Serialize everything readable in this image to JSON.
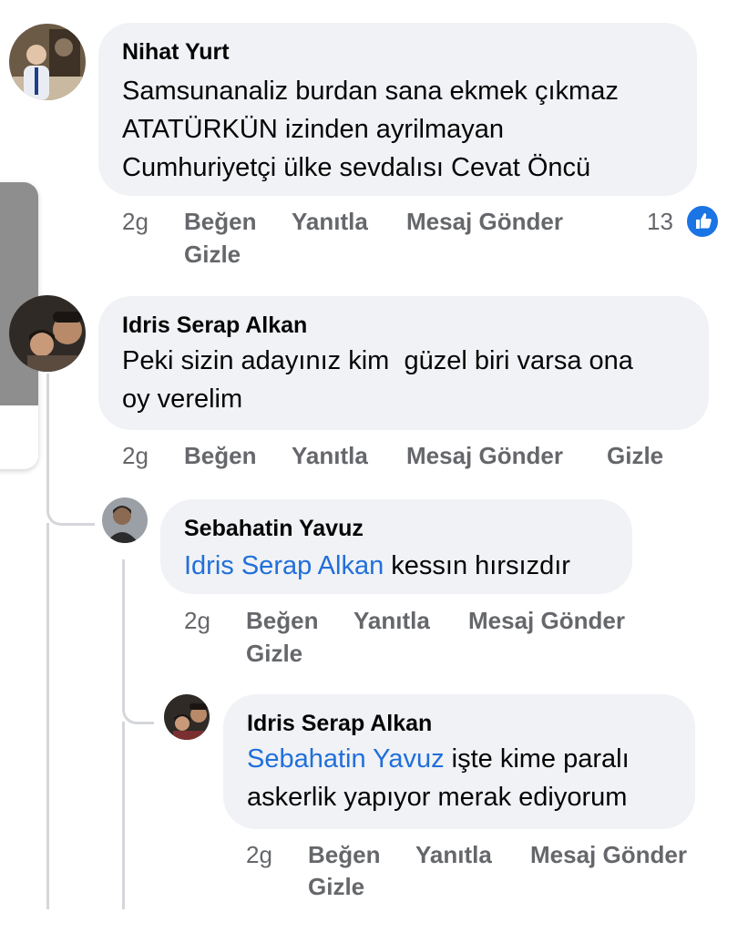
{
  "comments": [
    {
      "author": "Nihat Yurt",
      "lines": [
        "Samsunanaliz burdan sana ekmek çıkmaz",
        "ATATÜRKÜN izinden ayrilmayan",
        "Cumhuriyetçi ülke sevdalısı Cevat Öncü"
      ],
      "time": "2g",
      "actions": [
        "Beğen",
        "Yanıtla",
        "Mesaj Gönder",
        "Gizle"
      ],
      "reaction_count": "13",
      "reaction_icon": "thumbs-up-icon"
    },
    {
      "author": "Idris Serap Alkan",
      "lines": [
        "Peki sizin adayınız kim  güzel biri varsa ona",
        "oy verelim"
      ],
      "time": "2g",
      "actions": [
        "Beğen",
        "Yanıtla",
        "Mesaj Gönder",
        "Gizle"
      ]
    }
  ],
  "replies": [
    {
      "author": "Sebahatin Yavuz",
      "mention": "Idris Serap Alkan",
      "text": " kessın hırsızdır",
      "time": "2g",
      "actions": [
        "Beğen",
        "Yanıtla",
        "Mesaj Gönder",
        "Gizle"
      ]
    },
    {
      "author": "Idris Serap Alkan",
      "mention": "Sebahatin Yavuz",
      "text_line1": " işte kime paralı",
      "text_line2": "askerlik yapıyor merak ediyorum",
      "time": "2g",
      "actions": [
        "Beğen",
        "Yanıtla",
        "Mesaj Gönder",
        "Gizle"
      ]
    }
  ],
  "colors": {
    "bubble": "#f0f2f5",
    "mention": "#216fdb",
    "action_text": "#65676b",
    "like_blue": "#1b74e4"
  }
}
